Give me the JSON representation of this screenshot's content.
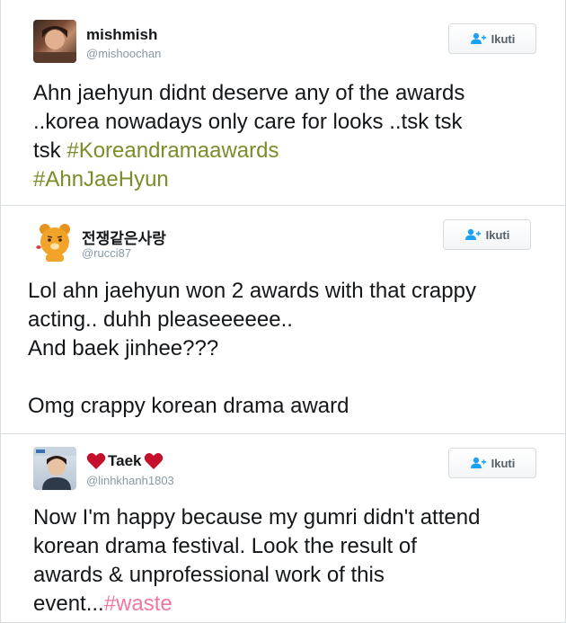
{
  "follow_label": "Ikuti",
  "tweets": [
    {
      "name": "mishmish",
      "handle": "@mishoochan",
      "text": "Ahn jaehyun didnt deserve any of the awards\n..korea nowadays only care for looks ..tsk tsk\ntsk ",
      "hashtags": [
        "#Koreandramaawards",
        "#AhnJaeHyun"
      ]
    },
    {
      "name": "전쟁같은사랑",
      "handle": "@rucci87",
      "text": "Lol ahn jaehyun won 2 awards with that crappy\nacting.. duhh pleaseeeeee..\nAnd baek jinhee???\n\nOmg crappy korean drama award"
    },
    {
      "name": "Taek",
      "handle": "@linhkhanh1803",
      "text": "Now I'm happy because my gumri didn't attend\nkorean drama festival. Look the result of\nawards & unprofessional work of this\nevent...",
      "hashtag": "#waste"
    }
  ],
  "colors": {
    "hashtag_green": "#7b8c2a",
    "hashtag_pink": "#ee77a6",
    "heart": "#c4102a"
  }
}
